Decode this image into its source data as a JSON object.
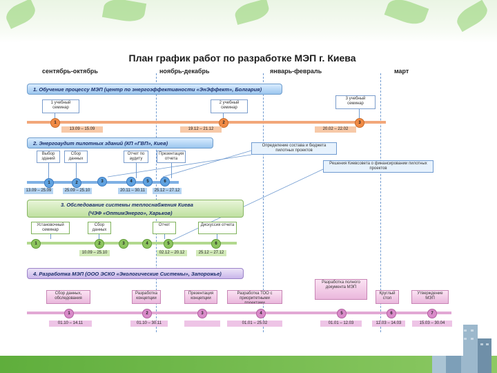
{
  "title": "План график  работ по разработке МЭП г. Киева",
  "months": [
    "сентябрь-октябрь",
    "ноябрь-декабрь",
    "январь-февраль",
    "март"
  ],
  "phase1": {
    "title": "1. Обучение процессу МЭП (центр по энергоэффективности «ЭнЭффект», Болгария)",
    "boxes": [
      "1 учебный семинар",
      "2 учебный семинар",
      "3 учебный семинар"
    ],
    "dots": [
      "1",
      "2",
      "3"
    ],
    "dates": [
      "13.09 – 15.09",
      "19.12 – 21.12",
      "20.02 – 22.02"
    ]
  },
  "phase2": {
    "title": "2. Энергоаудит пилотных зданий (КП «ГВП», Киев)",
    "boxes": [
      "Выбор зданий",
      "Сбор данных",
      "Отчет по аудиту",
      "Презентация отчета"
    ],
    "notes": [
      "Определение состава и бюджета пилотных проектов",
      "Решения Киевсовета о финансировании пилотных проектов"
    ],
    "dots": [
      "1",
      "2",
      "3",
      "4",
      "5",
      "6"
    ],
    "dates": [
      "13.09 – 25.09",
      "25.09 – 25.10",
      "20.11 – 30.11",
      "25.12 – 27.12"
    ]
  },
  "phase3": {
    "title": "3. Обследование системы теплоснабжения Киева",
    "subtitle": "(ЧЭФ «ОптимЭнерго», Харьков)",
    "boxes": [
      "Установочный семинар",
      "Сбор данных",
      "Отчет",
      "Дискуссия отчета"
    ],
    "dots": [
      "1",
      "2",
      "3",
      "4",
      "5",
      "6"
    ],
    "dates": [
      "10.09 – 25.10",
      "02.12 – 20.12",
      "25.12 – 27.12"
    ]
  },
  "phase4": {
    "title": "4. Разработка МЭП (ООО ЭСКО «Экологические Системы», Запорожье)",
    "boxes": [
      "Сбор данных, обследования",
      "Разработка концепции",
      "Презентация концепции",
      "Разработка ТОО с приоритетными проектами",
      "Разработка полного документа МЭП",
      "Круглый стол",
      "Утверждение МЭП"
    ],
    "dots": [
      "1",
      "2",
      "3",
      "4",
      "5",
      "6",
      "7"
    ],
    "dates": [
      "01.10 – 14.11",
      "01.10 – 30.11",
      "01.01 – 25.02",
      "01.01 – 12.03",
      "12.03 – 14.03",
      "15.03 – 30.04"
    ]
  }
}
